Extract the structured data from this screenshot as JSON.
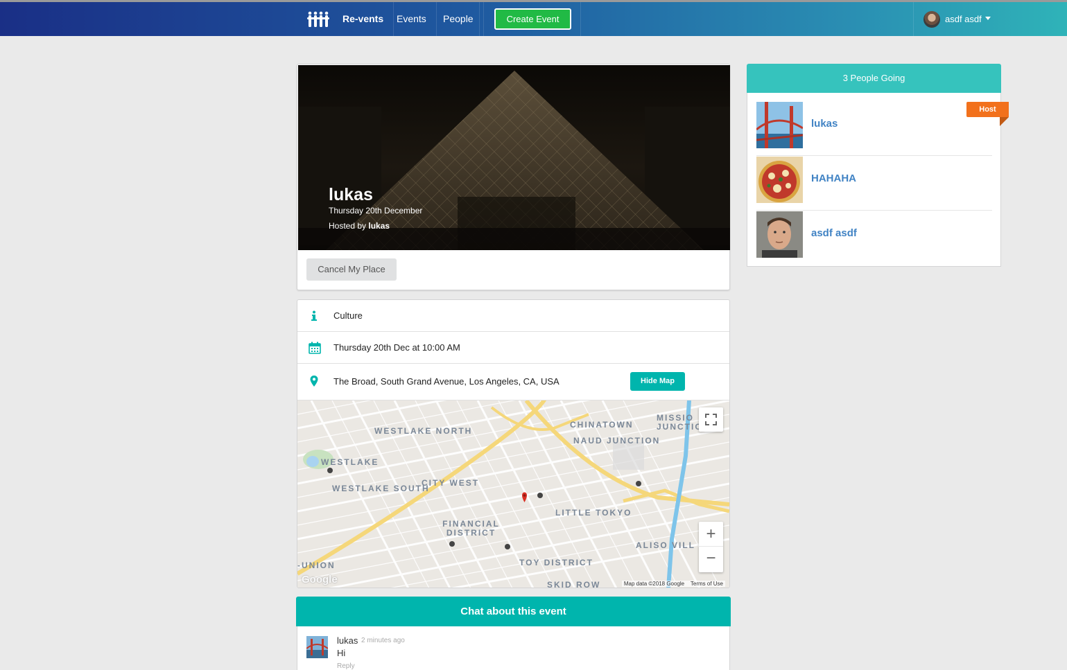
{
  "navbar": {
    "brand": "Re-vents",
    "events": "Events",
    "people": "People",
    "create_event": "Create Event",
    "username": "asdf asdf"
  },
  "event": {
    "title": "lukas",
    "date": "Thursday 20th December",
    "hosted_by_prefix": "Hosted by",
    "host": "lukas",
    "cancel_label": "Cancel My Place",
    "category": "Culture",
    "datetime": "Thursday 20th Dec at 10:00 AM",
    "venue": "The Broad, South Grand Avenue, Los Angeles, CA, USA",
    "hide_map_label": "Hide Map"
  },
  "map": {
    "labels": [
      "WESTLAKE NORTH",
      "WESTLAKE",
      "WESTLAKE SOUTH",
      "CITY WEST",
      "FINANCIAL DISTRICT",
      "CHINATOWN",
      "NAUD JUNCTION",
      "LITTLE TOKYO",
      "TOY DISTRICT",
      "ALISO VILL",
      "-UNION",
      "SKID ROW",
      "MISSIO JUNCTIO"
    ],
    "logo": "Google",
    "footer_data": "Map data ©2018 Google",
    "footer_terms": "Terms of Use",
    "zoom_in": "+",
    "zoom_out": "−"
  },
  "chat": {
    "header": "Chat about this event",
    "author": "lukas",
    "time": "2 minutes ago",
    "text": "Hi",
    "reply": "Reply"
  },
  "attendees": {
    "header": "3 People Going",
    "host_badge": "Host",
    "people": [
      {
        "name": "lukas"
      },
      {
        "name": "HAHAHA"
      },
      {
        "name": "asdf asdf"
      }
    ]
  },
  "colors": {
    "teal": "#00b5ad",
    "green": "#21ba45",
    "orange": "#f2711c",
    "link": "#4183c4"
  }
}
